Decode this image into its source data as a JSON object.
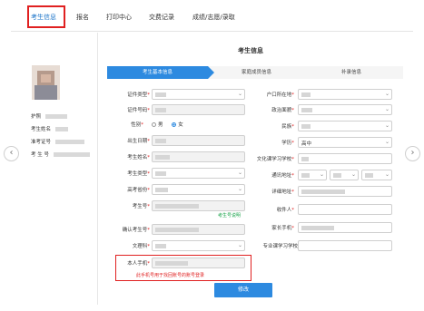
{
  "nav": {
    "items": [
      "考生信息",
      "报名",
      "打印中心",
      "交费记录",
      "成绩/志愿/录取"
    ],
    "active": "考生信息"
  },
  "sidebar": {
    "rows": [
      {
        "label": "护照"
      },
      {
        "label": "考生姓名"
      },
      {
        "label": "准考证号"
      },
      {
        "label": "考 生 号"
      }
    ]
  },
  "section_title": "考生信息",
  "tabs": [
    "考生基本信息",
    "家庭成员信息",
    "补录信息"
  ],
  "left_fields": [
    {
      "label": "证件类型",
      "required": true
    },
    {
      "label": "证件号码",
      "required": true
    },
    {
      "label": "性别",
      "required": true
    },
    {
      "label": "出生日期",
      "required": true
    },
    {
      "label": "考生姓名",
      "required": true
    },
    {
      "label": "考生类型",
      "required": true
    },
    {
      "label": "高考省份",
      "required": true
    },
    {
      "label": "考生号",
      "required": true
    },
    {
      "label": "确认考生号",
      "required": true
    },
    {
      "label": "文理科",
      "required": true
    },
    {
      "label": "本人手机",
      "required": true
    }
  ],
  "gender_options": [
    "男",
    "女"
  ],
  "exam_no_tip": "考生号说明",
  "right_fields": [
    {
      "label": "户口所在地",
      "required": true
    },
    {
      "label": "政治面貌",
      "required": true
    },
    {
      "label": "民族",
      "required": true
    },
    {
      "label": "学历",
      "required": true,
      "value": "高中"
    },
    {
      "label": "文化课学习学校",
      "required": true
    },
    {
      "label": "通讯地址",
      "required": true
    },
    {
      "label": "详细地址",
      "required": true
    },
    {
      "label": "收件人",
      "required": true
    },
    {
      "label": "家长手机",
      "required": true
    },
    {
      "label": "专业课学习学校",
      "required": false
    }
  ],
  "phone_warning": "此手机号用于找回账号的账号登录",
  "submit_label": "修改",
  "arrows": {
    "left": "‹",
    "right": "›"
  },
  "colors": {
    "accent": "#2d8ae0",
    "alert": "#e02020",
    "tip": "#1aa34a"
  }
}
